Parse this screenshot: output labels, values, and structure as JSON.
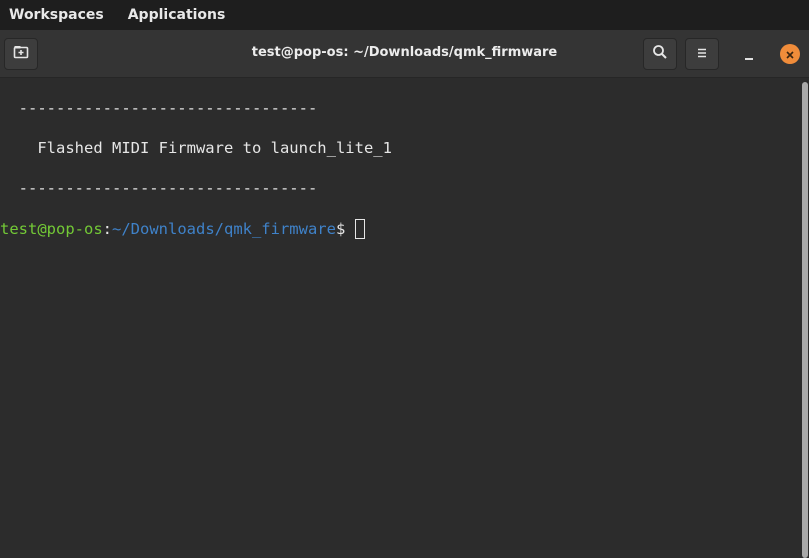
{
  "topbar": {
    "workspaces": "Workspaces",
    "applications": "Applications"
  },
  "window": {
    "title": "test@pop-os: ~/Downloads/qmk_firmware",
    "icons": {
      "new_tab": "new-tab-icon",
      "search": "search-icon",
      "menu": "hamburger-menu-icon",
      "minimize": "minimize-icon",
      "close": "close-icon"
    }
  },
  "terminal": {
    "lines": [
      "  --------------------------------",
      "    Flashed MIDI Firmware to launch_lite_1",
      "  --------------------------------"
    ],
    "prompt": {
      "user_host": "test@pop-os",
      "separator": ":",
      "path": "~/Downloads/qmk_firmware",
      "symbol": "$"
    }
  },
  "colors": {
    "prompt_user": "#73c936",
    "prompt_path": "#3f82c9",
    "close_button": "#f08c3a",
    "terminal_background": "#2c2c2c"
  }
}
